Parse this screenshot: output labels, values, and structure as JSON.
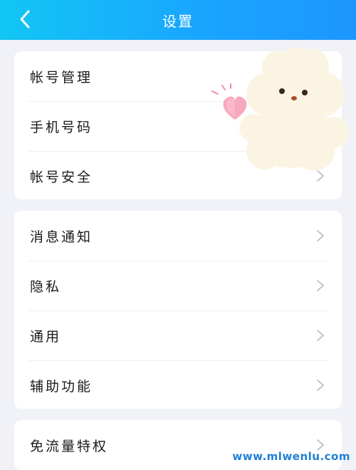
{
  "header": {
    "title": "设置",
    "back_icon": "chevron-left-icon"
  },
  "groups": [
    {
      "items": [
        {
          "label": "帐号管理",
          "has_chevron": false
        },
        {
          "label": "手机号码",
          "has_chevron": false
        },
        {
          "label": "帐号安全",
          "has_chevron": true
        }
      ]
    },
    {
      "items": [
        {
          "label": "消息通知",
          "has_chevron": true
        },
        {
          "label": "隐私",
          "has_chevron": true
        },
        {
          "label": "通用",
          "has_chevron": true
        },
        {
          "label": "辅助功能",
          "has_chevron": true
        }
      ]
    },
    {
      "items": [
        {
          "label": "免流量特权",
          "has_chevron": true
        }
      ]
    }
  ],
  "watermark": "www.mlwenlu.com",
  "colors": {
    "header_start": "#12c6f4",
    "header_end": "#1c97ff",
    "background": "#f0f2f7",
    "card": "#ffffff",
    "chevron": "#b8bcc4",
    "text": "#1a1a1a",
    "watermark": "#1e7fd6"
  }
}
